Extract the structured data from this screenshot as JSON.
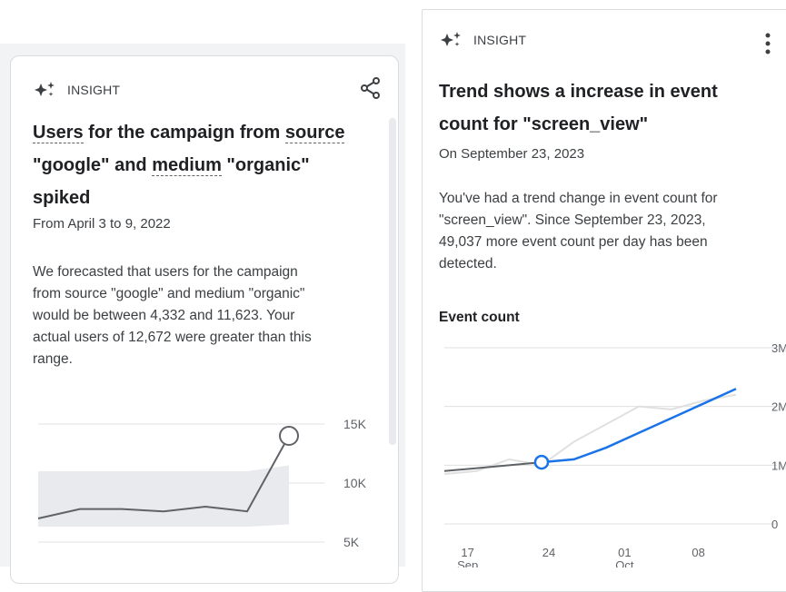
{
  "left_card": {
    "insight_label": "INSIGHT",
    "title": {
      "part1": "Users",
      "part2": " for the campaign from ",
      "part3": "source",
      "part4": "\"google\" and ",
      "part5": "medium",
      "part6": " \"organic\"",
      "part7": "spiked"
    },
    "date": "From April 3 to 9, 2022",
    "body": [
      "We forecasted that users for the campaign",
      "from source \"google\" and medium \"organic\"",
      "would be between 4,332 and 11,623. Your",
      "actual users of 12,672 were greater than this",
      "range."
    ],
    "icons": {
      "sparkle": "sparkle-icon",
      "share": "share-icon"
    }
  },
  "right_card": {
    "insight_label": "INSIGHT",
    "title_lines": [
      "Trend shows a increase in event",
      "count for \"screen_view\""
    ],
    "date": "On September 23, 2023",
    "body": [
      "You've had a trend change in event count for",
      "\"screen_view\". Since September 23, 2023,",
      "49,037 more event count per day has been",
      "detected."
    ],
    "chart_label": "Event count",
    "icons": {
      "sparkle": "sparkle-icon",
      "menu": "more-vert-icon"
    }
  },
  "chart_data": [
    {
      "type": "line",
      "series": [
        {
          "values": [
            7.0,
            7.8,
            7.8,
            7.6,
            8.0,
            7.6,
            14.0
          ]
        }
      ],
      "band": {
        "lower": [
          11.0,
          11.0,
          11.0,
          11.0,
          11.0,
          11.0,
          11.5
        ],
        "upper": [
          6.3,
          6.3,
          6.3,
          6.3,
          6.3,
          6.3,
          6.5
        ]
      },
      "y_ticks": [
        "15K",
        "10K",
        "5K"
      ],
      "colors": {
        "line": "#5f6368",
        "band": "#e8eaed",
        "point": "#5f6368"
      }
    },
    {
      "type": "line",
      "series": [
        {
          "values": [
            0.85,
            0.9,
            1.1,
            1.0,
            1.4,
            1.7,
            2.0,
            1.95,
            2.1,
            2.2
          ]
        },
        {
          "values": [
            0.9,
            0.95,
            1.0,
            1.05,
            1.1,
            1.3,
            1.55,
            1.8,
            2.05,
            2.3
          ]
        }
      ],
      "y_ticks": [
        "3M",
        "2M",
        "1M",
        "0"
      ],
      "x_ticks": [
        {
          "day": "17",
          "month": "Sep"
        },
        {
          "day": "24",
          "month": ""
        },
        {
          "day": "01",
          "month": "Oct"
        },
        {
          "day": "08",
          "month": ""
        }
      ],
      "colors": {
        "actual": "#e0e0e0",
        "before": "#5f6368",
        "trend": "#1a73e8"
      }
    }
  ]
}
